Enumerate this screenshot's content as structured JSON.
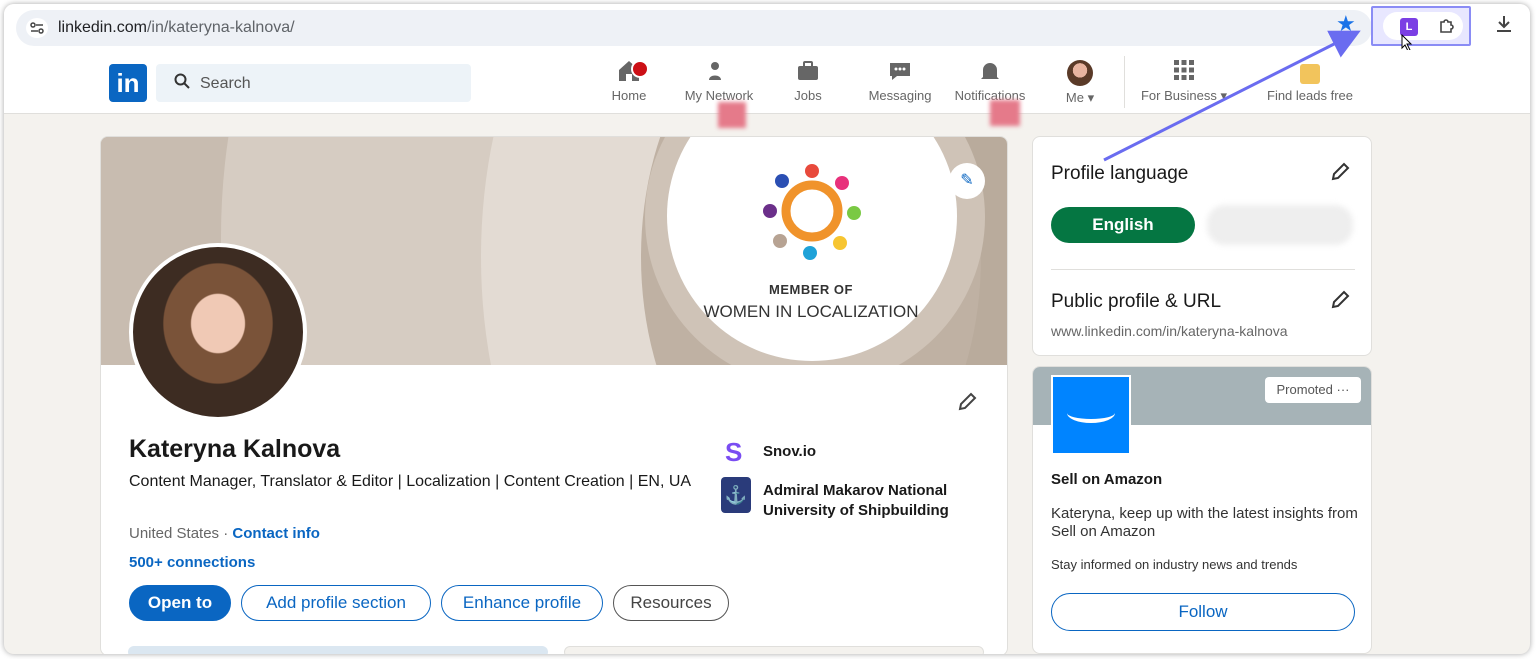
{
  "browser": {
    "url_host": "linkedin.com",
    "url_path": "/in/kateryna-kalnova/",
    "extension_letter": "L",
    "colors": {
      "bookmark_star": "#1a73e8",
      "highlight_box": "#8a8cf5",
      "extension": "#7b3fe4"
    }
  },
  "nav": {
    "logo_text": "in",
    "search_placeholder": "Search",
    "items": [
      {
        "label": "Home",
        "icon": "home-icon"
      },
      {
        "label": "My Network",
        "icon": "network-icon"
      },
      {
        "label": "Jobs",
        "icon": "briefcase-icon"
      },
      {
        "label": "Messaging",
        "icon": "chat-icon"
      },
      {
        "label": "Notifications",
        "icon": "bell-icon"
      },
      {
        "label": "Me",
        "icon": "avatar"
      },
      {
        "label": "For Business",
        "icon": "grid-icon"
      },
      {
        "label": "Find leads free",
        "icon": "leads-icon"
      }
    ]
  },
  "profile": {
    "banner_member": "MEMBER OF",
    "banner_org": "WOMEN IN LOCALIZATION",
    "name": "Kateryna Kalnova",
    "headline": "Content Manager, Translator & Editor | Localization | Content Creation | EN, UA",
    "location": "United States",
    "separator": "·",
    "contact_info": "Contact info",
    "connections": "500+ connections",
    "org1_icon": "S",
    "org1": "Snov.io",
    "org2_line1": "Admiral Makarov National",
    "org2_line2": "University of Shipbuilding",
    "buttons": {
      "open_to": "Open to",
      "add_section": "Add profile section",
      "enhance": "Enhance profile",
      "resources": "Resources"
    },
    "colors": {
      "primary": "#0a66c2",
      "banner": "#b9ab9c"
    }
  },
  "sidebar": {
    "profile_language_title": "Profile language",
    "language_button": "English",
    "public_profile_title": "Public profile & URL",
    "public_url": "www.linkedin.com/in/kateryna-kalnova",
    "colors": {
      "language_button": "#057642"
    }
  },
  "ad": {
    "promoted": "Promoted ···",
    "title": "Sell on Amazon",
    "description": "Kateryna, keep up with the latest insights from Sell on Amazon",
    "subtext": "Stay informed on industry news and trends",
    "follow": "Follow",
    "colors": {
      "logo": "#0084ff"
    }
  }
}
